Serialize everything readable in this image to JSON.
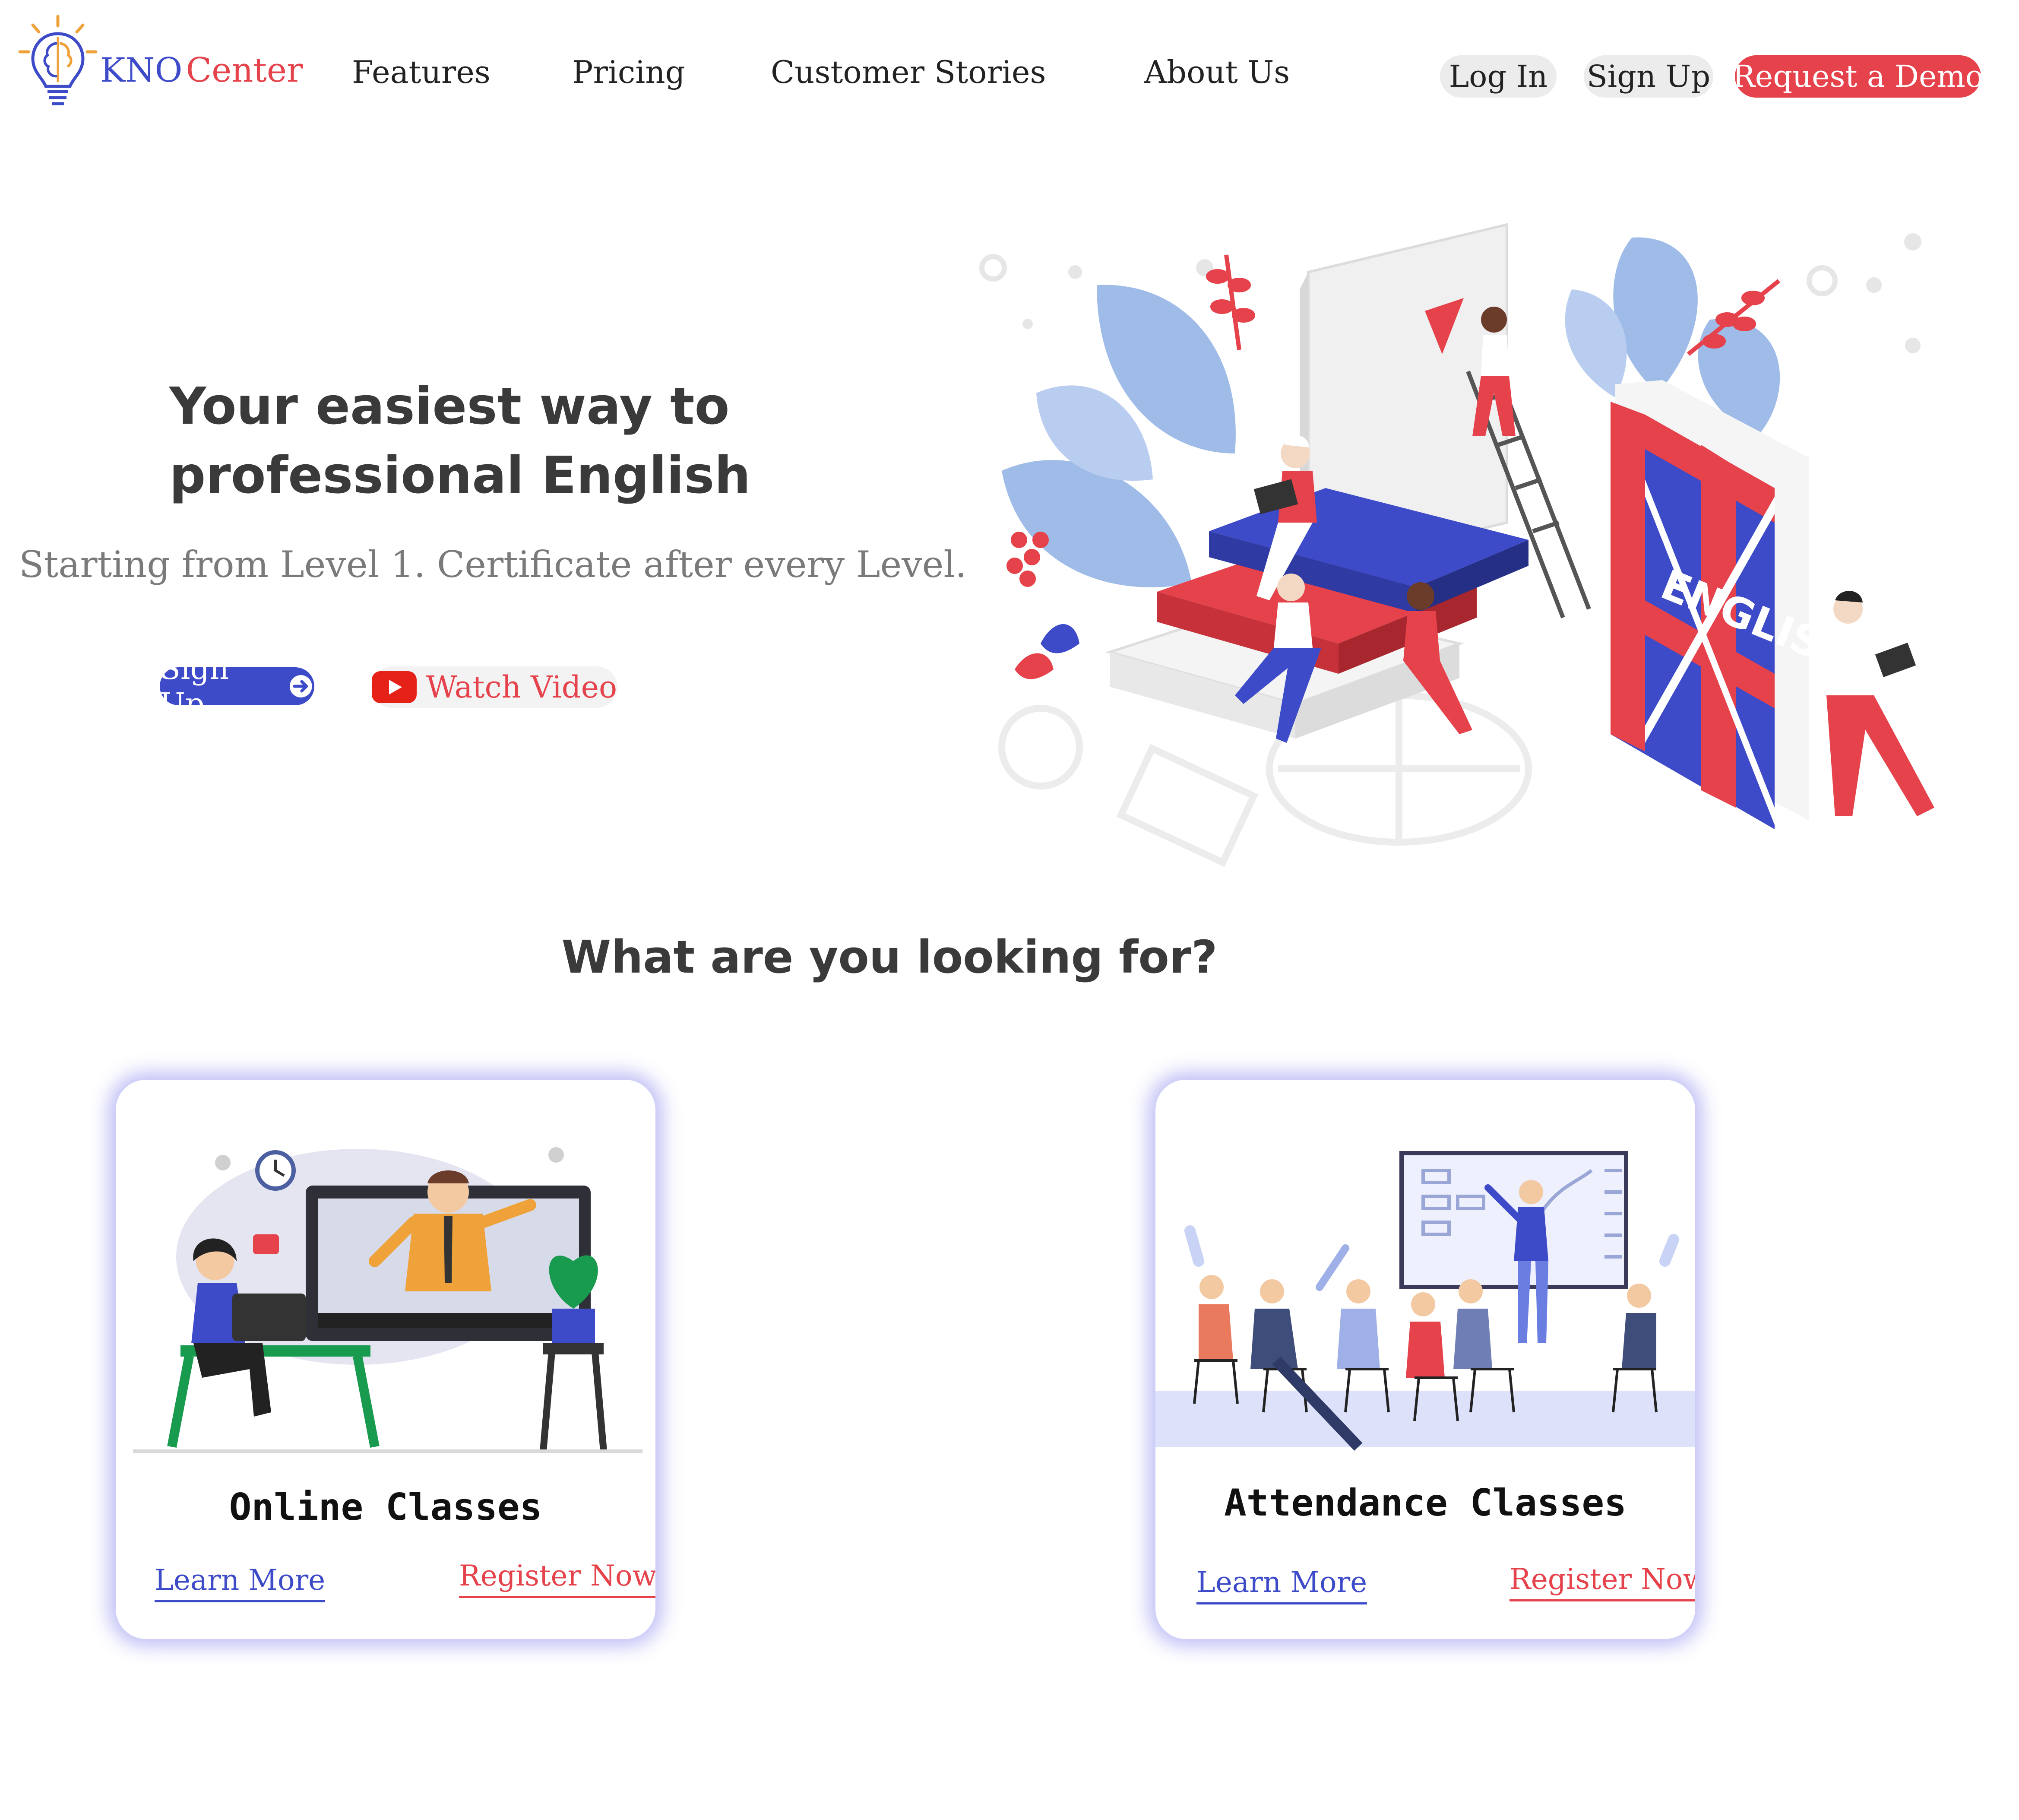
{
  "brand": {
    "kno": "KNO",
    "center": "Center",
    "logo_icon": "brain-lightbulb-icon"
  },
  "nav": {
    "features": "Features",
    "pricing": "Pricing",
    "customer_stories": "Customer Stories",
    "about_us": "About Us",
    "log_in": "Log In",
    "sign_up": "Sign Up",
    "request_demo": "Request a Demo"
  },
  "hero": {
    "title_line1": "Your easiest way to",
    "title_line2": "professional English",
    "subtitle": "Starting from Level 1. Certificate after every Level.",
    "signup_label": "Sign Up",
    "watch_label": "Watch Video",
    "book_label": "ENGLISH"
  },
  "section": {
    "title": "What are you looking for?"
  },
  "cards": [
    {
      "title": "Online Classes",
      "learn_more": "Learn More",
      "register_now": "Register Now"
    },
    {
      "title": "Attendance Classes",
      "learn_more": "Learn More",
      "register_now": "Register Now"
    }
  ],
  "colors": {
    "brand_blue": "#3d4bc9",
    "brand_red": "#e5424b",
    "card_glow": "#5c5ce8"
  }
}
